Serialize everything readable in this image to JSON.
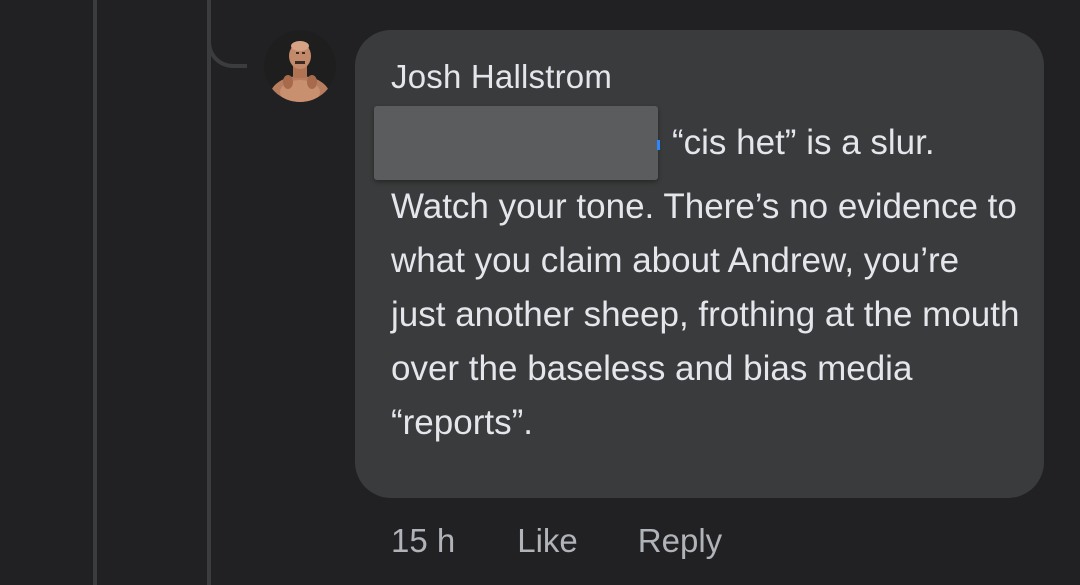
{
  "comment": {
    "author": "Josh Hallstrom",
    "text": "“cis het” is a slur. Watch your tone. There’s no evidence to what you claim about Andrew, you’re just another sheep, frothing at the mouth over the baseless and bias media “reports”.",
    "mention_redacted": true,
    "avatar_icon": "user-avatar-photo"
  },
  "actions": {
    "timestamp": "15 h",
    "like_label": "Like",
    "reply_label": "Reply"
  },
  "colors": {
    "background": "#212123",
    "bubble": "#3a3b3c",
    "primary_text": "#e4e6eb",
    "secondary_text": "#b0b3b8",
    "thread_line": "#3b3c3e"
  }
}
